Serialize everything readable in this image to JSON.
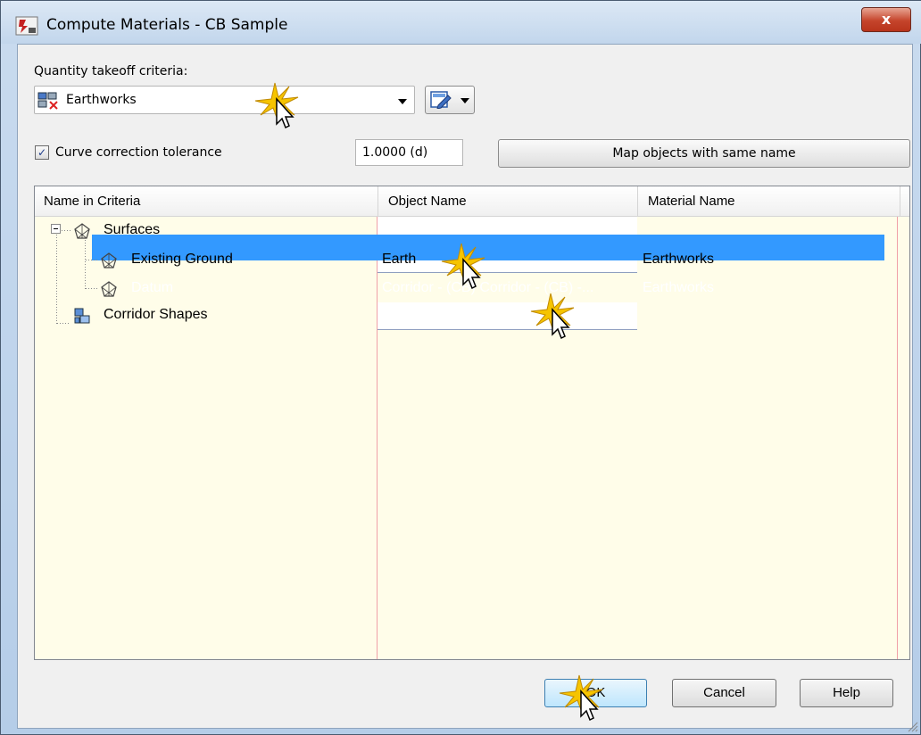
{
  "window": {
    "title": "Compute Materials - CB Sample",
    "close_label": "x"
  },
  "criteria": {
    "label": "Quantity takeoff criteria:",
    "selected": "Earthworks"
  },
  "curve": {
    "checked": true,
    "label": "Curve correction tolerance",
    "value": "1.0000 (d)"
  },
  "map_button": "Map objects with same name",
  "grid": {
    "columns": [
      "Name in Criteria",
      "Object Name",
      "Material Name"
    ],
    "rows": [
      {
        "name": "Surfaces",
        "object": "",
        "material": ""
      },
      {
        "name": "Existing Ground",
        "object": "Earth",
        "material": "Earthworks"
      },
      {
        "name": "Datum",
        "object": "Corridor - (CB) Corridor - (CB) -...",
        "material": "Earthworks"
      },
      {
        "name": "Corridor Shapes",
        "object": "",
        "material": ""
      }
    ]
  },
  "buttons": {
    "ok": "OK",
    "cancel": "Cancel",
    "help": "Help"
  },
  "colors": {
    "selection": "#3399ff",
    "grid_background": "#fffde9",
    "close_button": "#c5442b",
    "column_line": "#f0a0a8"
  }
}
